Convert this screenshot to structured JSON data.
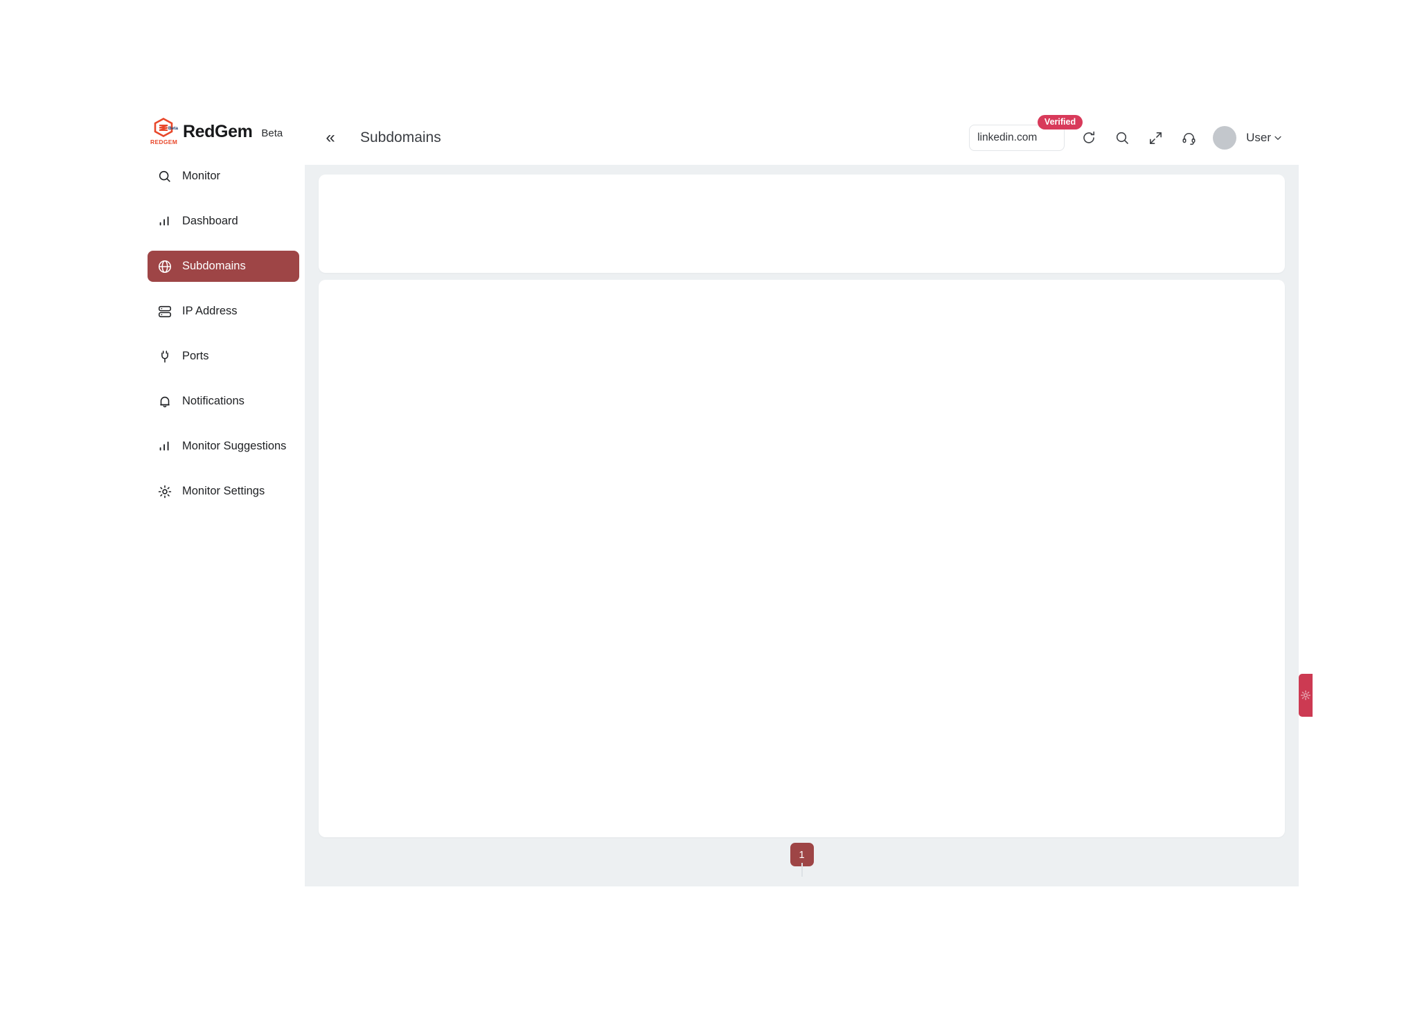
{
  "brand": {
    "logo_word": "REDGEM",
    "logo_beta": "Beta",
    "name": "RedGem",
    "beta_label": "Beta",
    "logo_color": "#E8472A"
  },
  "sidebar": {
    "items": [
      {
        "label": "Monitor",
        "icon": "search-icon",
        "active": false
      },
      {
        "label": "Dashboard",
        "icon": "bar-chart-icon",
        "active": false
      },
      {
        "label": "Subdomains",
        "icon": "globe-icon",
        "active": true
      },
      {
        "label": "IP Address",
        "icon": "server-icon",
        "active": false
      },
      {
        "label": "Ports",
        "icon": "plug-icon",
        "active": false
      },
      {
        "label": "Notifications",
        "icon": "bell-icon",
        "active": false
      },
      {
        "label": "Monitor Suggestions",
        "icon": "bar-chart-icon",
        "active": false
      },
      {
        "label": "Monitor Settings",
        "icon": "gear-icon",
        "active": false
      }
    ],
    "active_color": "#9E4546"
  },
  "topbar": {
    "collapse_icon": "«",
    "page_title": "Subdomains",
    "domain_value": "linkedin.com",
    "domain_placeholder": "linkedin.com",
    "verified_badge": "Verified",
    "verified_color": "#D83A5A",
    "refresh_icon": "refresh-icon",
    "search_icon": "search-icon",
    "fullscreen_icon": "fullscreen-icon",
    "support_icon": "headset-icon",
    "user_label": "User",
    "user_caret": "⌄"
  },
  "content": {
    "pagination": {
      "pages": [
        "1"
      ],
      "current": "1"
    },
    "side_tab": {
      "icon": "gear-icon",
      "color": "#CC3A52"
    }
  }
}
